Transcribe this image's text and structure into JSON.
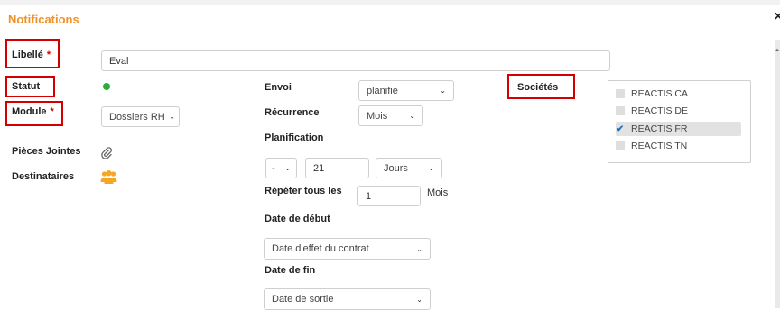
{
  "header": {
    "title": "Notifications",
    "close_icon": "close-icon"
  },
  "form": {
    "libelle": {
      "label": "Libellé",
      "required": "*",
      "value": "Eval"
    },
    "statut": {
      "label": "Statut",
      "indicator_color": "#2dab3d"
    },
    "module": {
      "label": "Module",
      "required": "*",
      "value": "Dossiers RH"
    },
    "pieces_jointes": {
      "label": "Pièces Jointes",
      "icon": "paperclip-icon"
    },
    "destinataires": {
      "label": "Destinataires",
      "icon": "users-icon"
    }
  },
  "schedule": {
    "envoi": {
      "label": "Envoi",
      "value": "planifié"
    },
    "recurrence": {
      "label": "Récurrence",
      "value": "Mois"
    },
    "planification": {
      "label": "Planification",
      "offset_sign": "-",
      "amount": "21",
      "unit": "Jours"
    },
    "repeter": {
      "label": "Répéter tous les",
      "value": "1",
      "unit": "Mois"
    },
    "date_debut": {
      "label": "Date de début",
      "value": "Date d'effet du contrat"
    },
    "date_fin": {
      "label": "Date de fin",
      "value": "Date de sortie"
    }
  },
  "societes": {
    "label": "Sociétés",
    "items": [
      {
        "label": "REACTIS CA",
        "checked": false
      },
      {
        "label": "REACTIS DE",
        "checked": false
      },
      {
        "label": "REACTIS FR",
        "checked": true
      },
      {
        "label": "REACTIS TN",
        "checked": false
      }
    ]
  },
  "colors": {
    "accent": "#f0922b",
    "highlight_box": "#d40000",
    "status_ok": "#2dab3d",
    "check": "#1e73be",
    "users_icon": "#f5a623"
  }
}
